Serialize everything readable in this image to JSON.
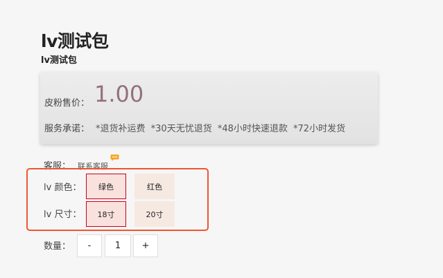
{
  "product": {
    "title": "lv测试包",
    "subtitle": "lv测试包"
  },
  "price": {
    "label": "皮粉售价：",
    "value": "1.00",
    "color": "#94717a"
  },
  "service": {
    "label": "服务承诺：",
    "items": [
      "*退货补运费",
      "*30天无忧退货",
      "*48小时快速退款",
      "*72小时发货"
    ]
  },
  "customer_service": {
    "label": "客服：",
    "link": "联系客服",
    "icon": "chat-bubble-icon"
  },
  "attributes": {
    "color": {
      "label": "lv 颜色：",
      "options": [
        "绿色",
        "红色"
      ],
      "selected": "绿色"
    },
    "size": {
      "label": "lv 尺寸：",
      "options": [
        "18寸",
        "20寸"
      ],
      "selected": "18寸"
    }
  },
  "quantity": {
    "label": "数量：",
    "minus": "-",
    "value": "1",
    "plus": "+"
  },
  "colors": {
    "highlight": "#f0542d",
    "selected_border": "#c7001f",
    "option_bg": "#f6e9e2"
  }
}
